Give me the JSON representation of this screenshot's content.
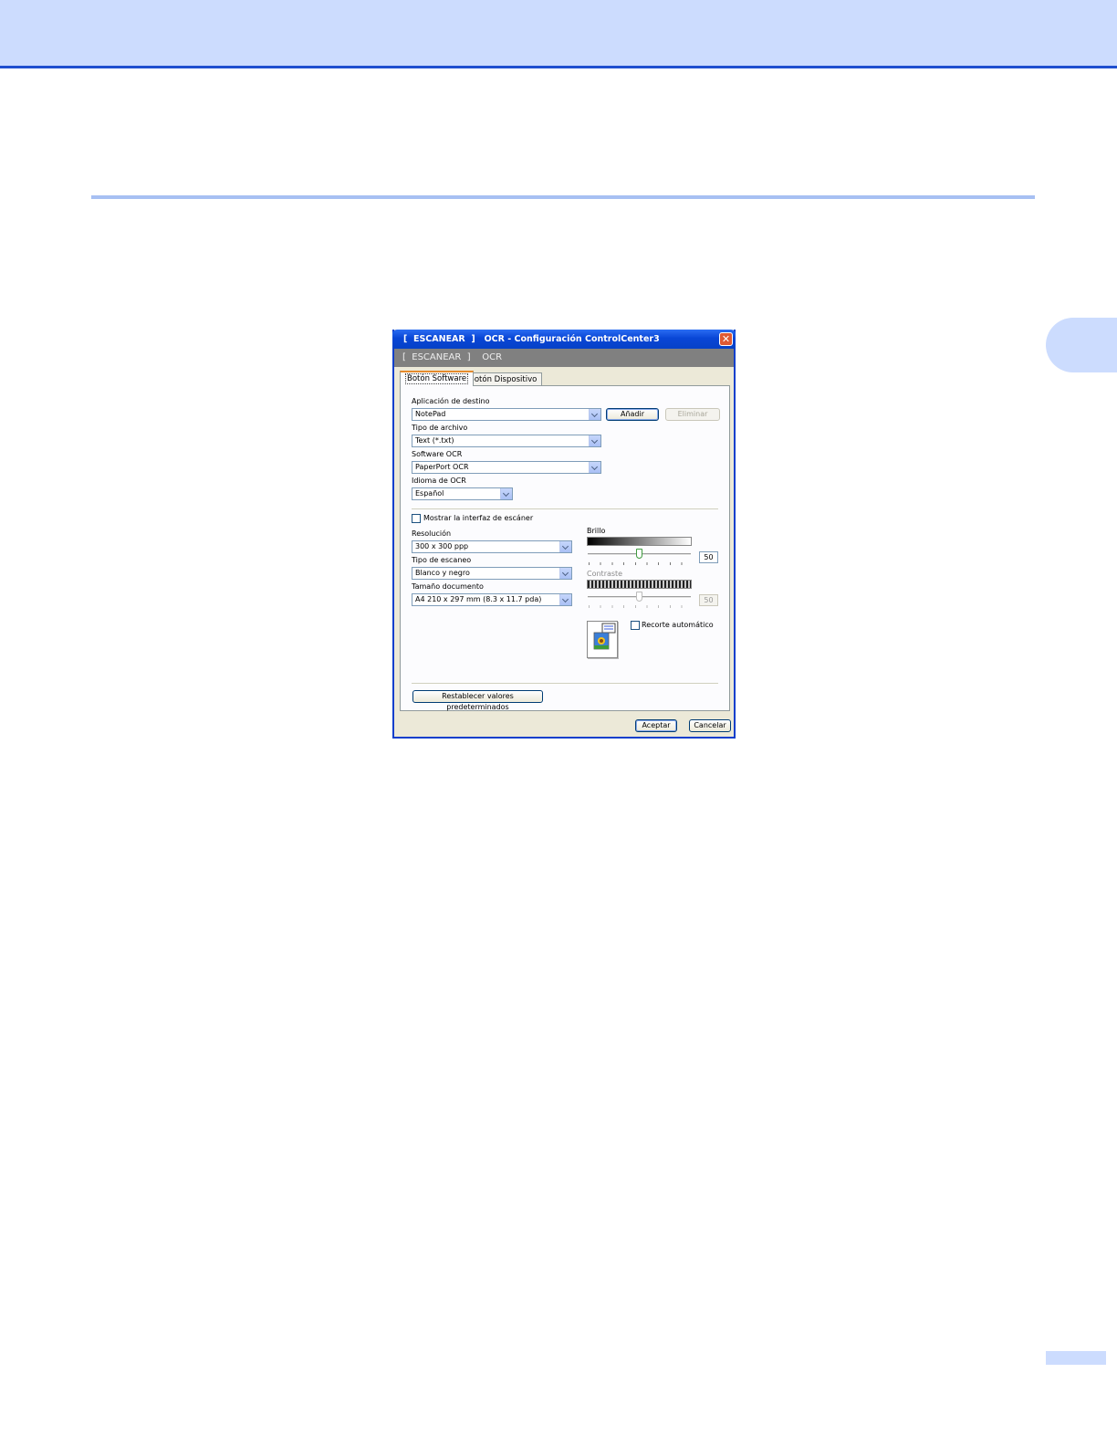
{
  "window": {
    "title": "[  ESCANEAR  ]   OCR - Configuración ControlCenter3",
    "banner": "[  ESCANEAR  ]    OCR",
    "close_glyph": "✕"
  },
  "tabs": [
    {
      "label": "Botón Software",
      "active": true
    },
    {
      "label": "Botón Dispositivo",
      "active": false
    }
  ],
  "software_tab": {
    "target_app_label": "Aplicación de destino",
    "target_app_value": "NotePad",
    "add_button": "Añadir",
    "delete_button": "Eliminar",
    "file_type_label": "Tipo de archivo",
    "file_type_value": "Text (*.txt)",
    "ocr_software_label": "Software OCR",
    "ocr_software_value": "PaperPort OCR",
    "ocr_language_label": "Idioma de OCR",
    "ocr_language_value": "Español",
    "show_scanner_interface_label": "Mostrar la interfaz de escáner",
    "show_scanner_interface_checked": false,
    "resolution_label": "Resolución",
    "resolution_value": "300 x 300 ppp",
    "scan_type_label": "Tipo de escaneo",
    "scan_type_value": "Blanco y negro",
    "doc_size_label": "Tamaño documento",
    "doc_size_value": "A4 210 x 297 mm (8.3 x 11.7 pda)",
    "brightness_label": "Brillo",
    "brightness_value": "50",
    "contrast_label": "Contraste",
    "contrast_value": "50",
    "auto_crop_label": "Recorte automático",
    "auto_crop_checked": false,
    "restore_defaults_button": "Restablecer valores predeterminados"
  },
  "footer": {
    "ok_button": "Aceptar",
    "cancel_button": "Cancelar"
  }
}
